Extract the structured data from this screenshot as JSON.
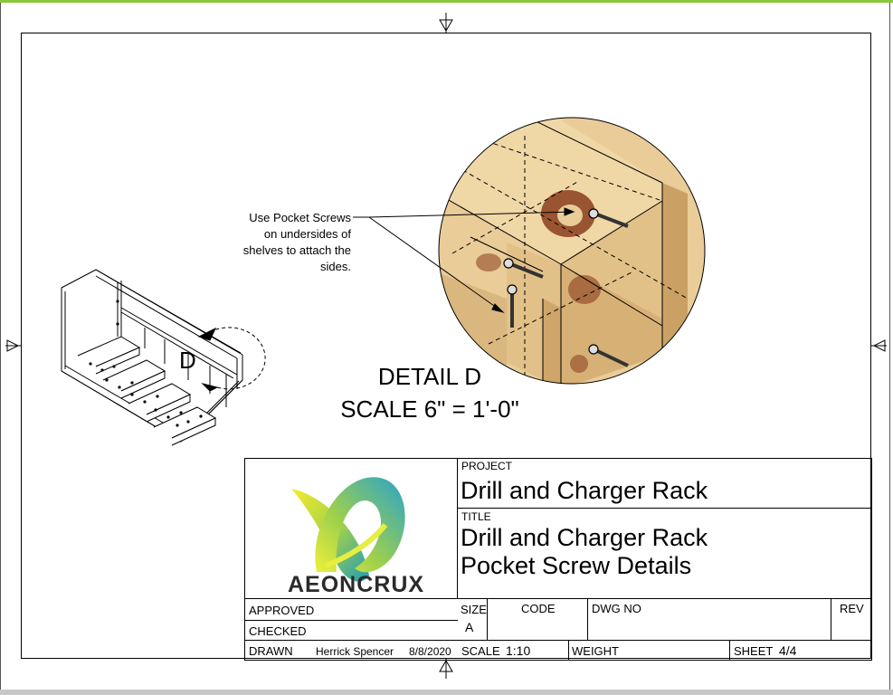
{
  "note": {
    "lines": [
      "Use Pocket Screws",
      "on undersides of",
      "shelves to attach the",
      "sides."
    ]
  },
  "detail": {
    "marker": "D",
    "title": "DETAIL D",
    "scale": "SCALE 6\" = 1'-0\""
  },
  "title_block": {
    "logo_text": "AEONCRUX",
    "project_label": "PROJECT",
    "project_value": "Drill and Charger Rack",
    "title_label": "TITLE",
    "title_line1": "Drill and Charger Rack",
    "title_line2": "Pocket Screw Details",
    "approved_label": "APPROVED",
    "checked_label": "CHECKED",
    "drawn_label": "DRAWN",
    "drawn_by": "Herrick Spencer",
    "drawn_date": "8/8/2020",
    "size_label": "SIZE",
    "size_value": "A",
    "code_label": "CODE",
    "dwg_no_label": "DWG NO",
    "rev_label": "REV",
    "scale_label": "SCALE",
    "scale_value": "1:10",
    "weight_label": "WEIGHT",
    "sheet_label": "SHEET",
    "sheet_value": "4/4"
  },
  "colors": {
    "accent_bar": "#8cc43c",
    "wood_light": "#e6c893",
    "wood_dark": "#c79a5c",
    "knot": "#8a3d1c"
  }
}
